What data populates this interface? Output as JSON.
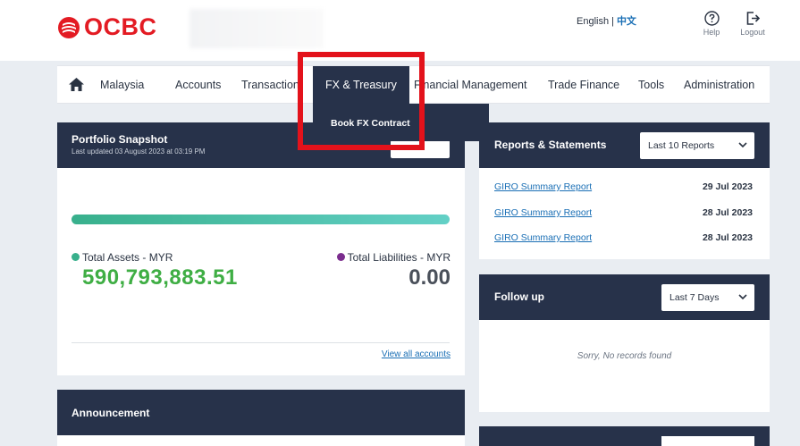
{
  "header": {
    "brand": "OCBC",
    "language": {
      "english": "English",
      "separator": "|",
      "chinese": "中文"
    },
    "help_label": "Help",
    "logout_label": "Logout"
  },
  "nav": {
    "home_icon": "home-icon",
    "items": [
      {
        "label": "Malaysia"
      },
      {
        "label": "Accounts"
      },
      {
        "label": "Transaction"
      },
      {
        "label": "FX & Treasury",
        "active": true
      },
      {
        "label": "Financial Management"
      },
      {
        "label": "Trade Finance"
      },
      {
        "label": "Tools"
      },
      {
        "label": "Administration"
      }
    ],
    "dropdown": {
      "item": "Book FX Contract"
    }
  },
  "portfolio": {
    "title": "Portfolio Snapshot",
    "updated": "Last updated 03 August 2023 at 03:19 PM",
    "total_assets_label": "Total Assets - MYR",
    "total_assets_value": "590,793,883.51",
    "total_liabilities_label": "Total Liabilities - MYR",
    "total_liabilities_value": "0.00",
    "view_all": "View all accounts",
    "colors": {
      "assets": "#3fae44",
      "assets_dot": "#38b08c",
      "liabilities_dot": "#7b2d8e"
    }
  },
  "announcement": {
    "title": "Announcement"
  },
  "reports": {
    "title": "Reports & Statements",
    "filter": "Last 10 Reports",
    "rows": [
      {
        "name": "GIRO Summary Report",
        "date": "29 Jul 2023"
      },
      {
        "name": "GIRO Summary Report",
        "date": "28 Jul 2023"
      },
      {
        "name": "GIRO Summary Report",
        "date": "28 Jul 2023"
      }
    ]
  },
  "followup": {
    "title": "Follow up",
    "filter": "Last 7 Days",
    "empty_message": "Sorry, No records found"
  },
  "theme": {
    "navy": "#27324a",
    "brand_red": "#e31b23",
    "link_blue": "#1a6fb5",
    "highlight_red": "#e3121b"
  }
}
